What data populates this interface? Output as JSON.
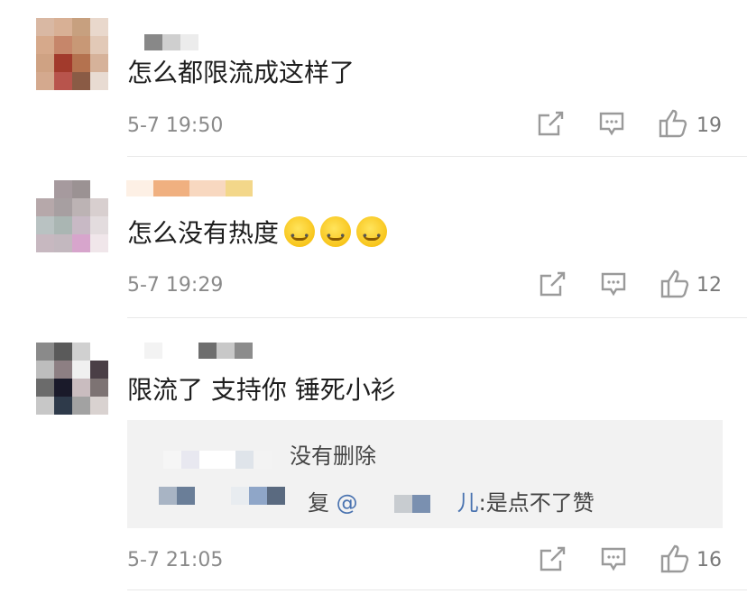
{
  "comments": [
    {
      "text": "怎么都限流成这样了",
      "time": "5-7 19:50",
      "likes": "19",
      "actions": [
        "share-icon",
        "comment-icon",
        "like-icon"
      ]
    },
    {
      "text": "怎么没有热度",
      "emoji_count": 3,
      "emoji": "smirk-emoji",
      "time": "5-7 19:29",
      "likes": "12",
      "actions": [
        "share-icon",
        "comment-icon",
        "like-icon"
      ]
    },
    {
      "text": "限流了 支持你 锤死小衫",
      "time": "5-7 21:05",
      "likes": "16",
      "actions": [
        "share-icon",
        "comment-icon",
        "like-icon"
      ],
      "reply_box": {
        "line1_visible": "没有删除",
        "line2_mention": "@",
        "line2_fragment1": "复",
        "line2_mention_tail": "儿",
        "line2_text": ":是点不了赞"
      }
    }
  ],
  "colors": {
    "icon": "#9a9a9a",
    "meta_text": "#8a8a8a",
    "mention": "#4a73b0",
    "reply_bg": "#f2f2f2"
  }
}
